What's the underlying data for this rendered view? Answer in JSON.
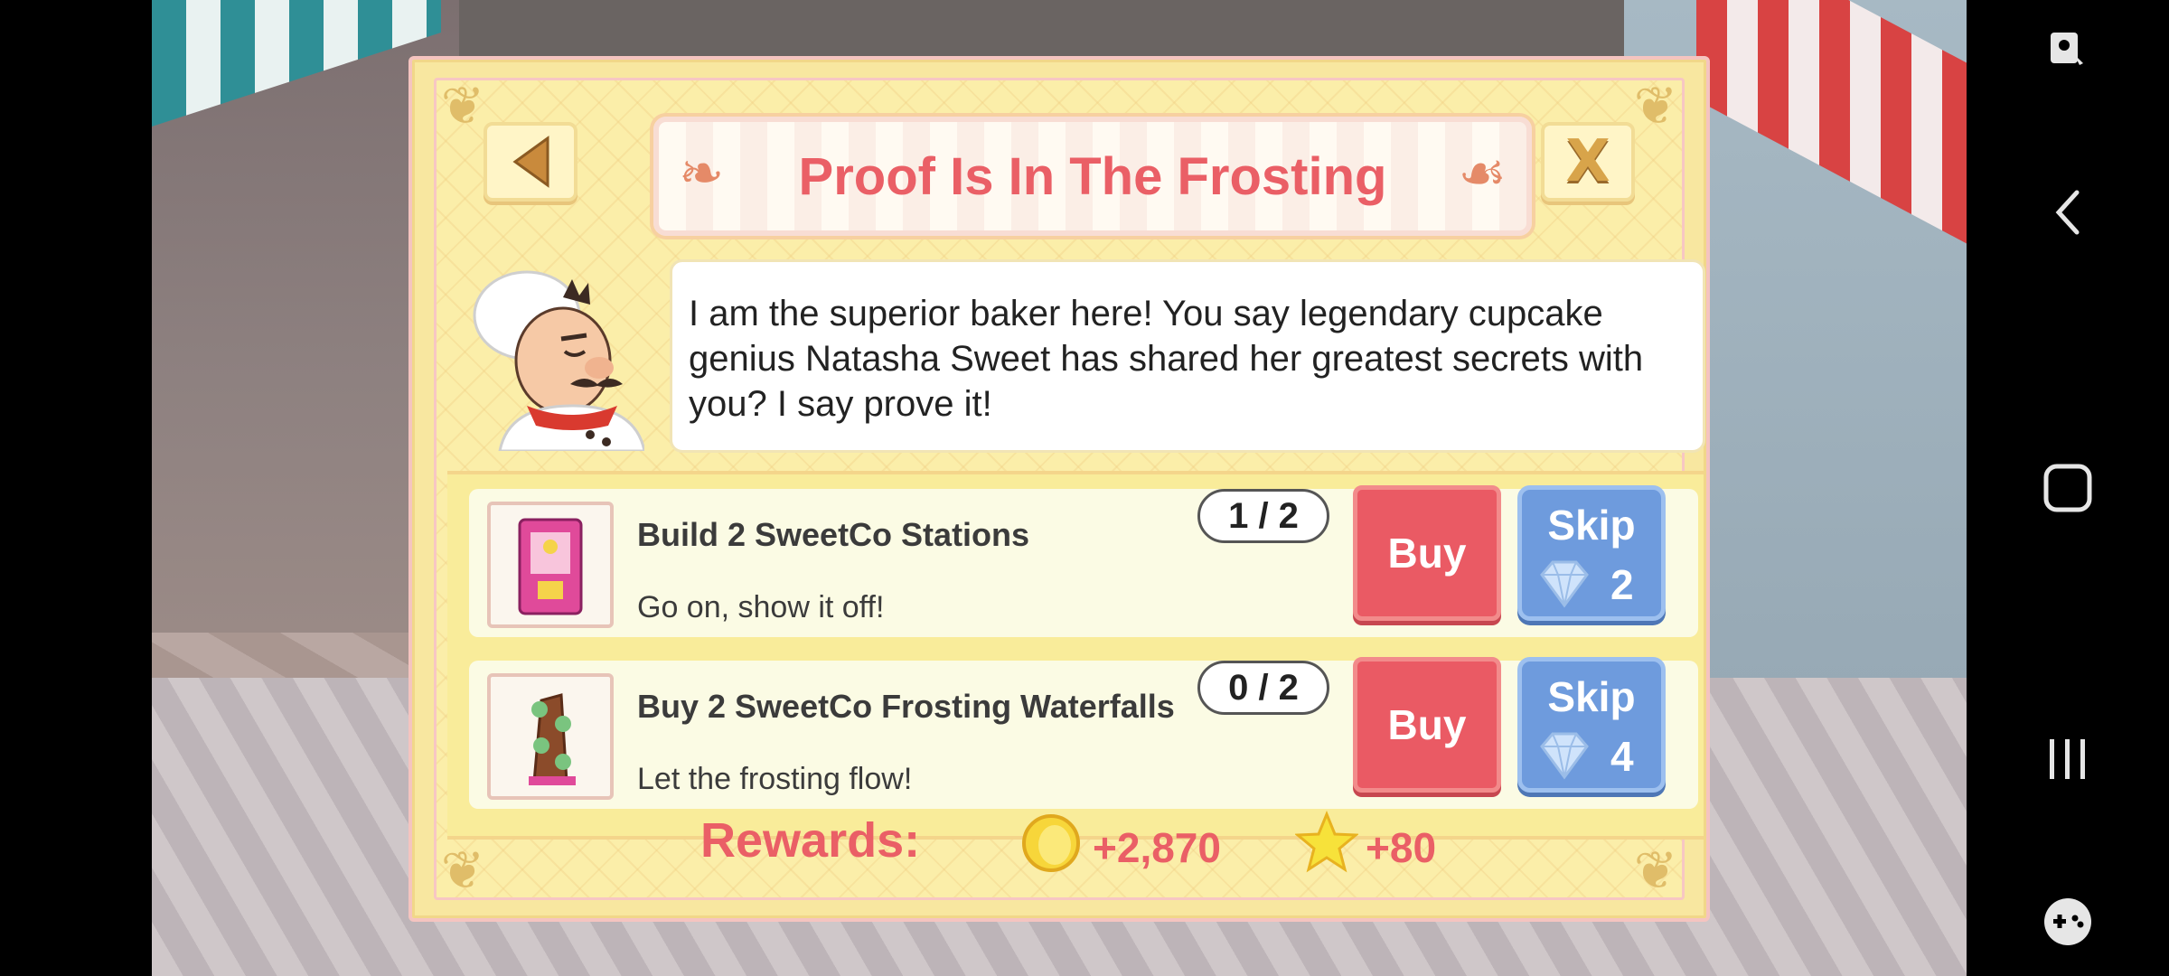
{
  "dialog": {
    "title": "Proof Is In The Frosting",
    "message": "I am the superior baker here! You say legendary cupcake genius Natasha Sweet has shared her greatest secrets with you? I say prove it!",
    "back_icon": "back-triangle-icon",
    "close_label": "X"
  },
  "tasks": [
    {
      "title": "Build 2 SweetCo Stations",
      "subtitle": "Go on, show it off!",
      "progress": "1 / 2",
      "buy_label": "Buy",
      "skip_label": "Skip",
      "skip_cost": "2",
      "icon": "sweetco-station-icon"
    },
    {
      "title": "Buy 2 SweetCo Frosting Waterfalls",
      "subtitle": "Let the frosting flow!",
      "progress": "0 / 2",
      "buy_label": "Buy",
      "skip_label": "Skip",
      "skip_cost": "4",
      "icon": "frosting-waterfall-icon"
    }
  ],
  "rewards": {
    "label": "Rewards:",
    "coins": "+2,870",
    "xp": "+80"
  },
  "colors": {
    "accent": "#ea5f66",
    "buy": "#ea5a64",
    "skip": "#6e9bdd",
    "panel": "#f8e7a0"
  },
  "navbar": {
    "icons": [
      "screenshot-edit-icon",
      "back-chevron-icon",
      "home-square-icon",
      "recents-icon",
      "game-launcher-icon"
    ]
  }
}
